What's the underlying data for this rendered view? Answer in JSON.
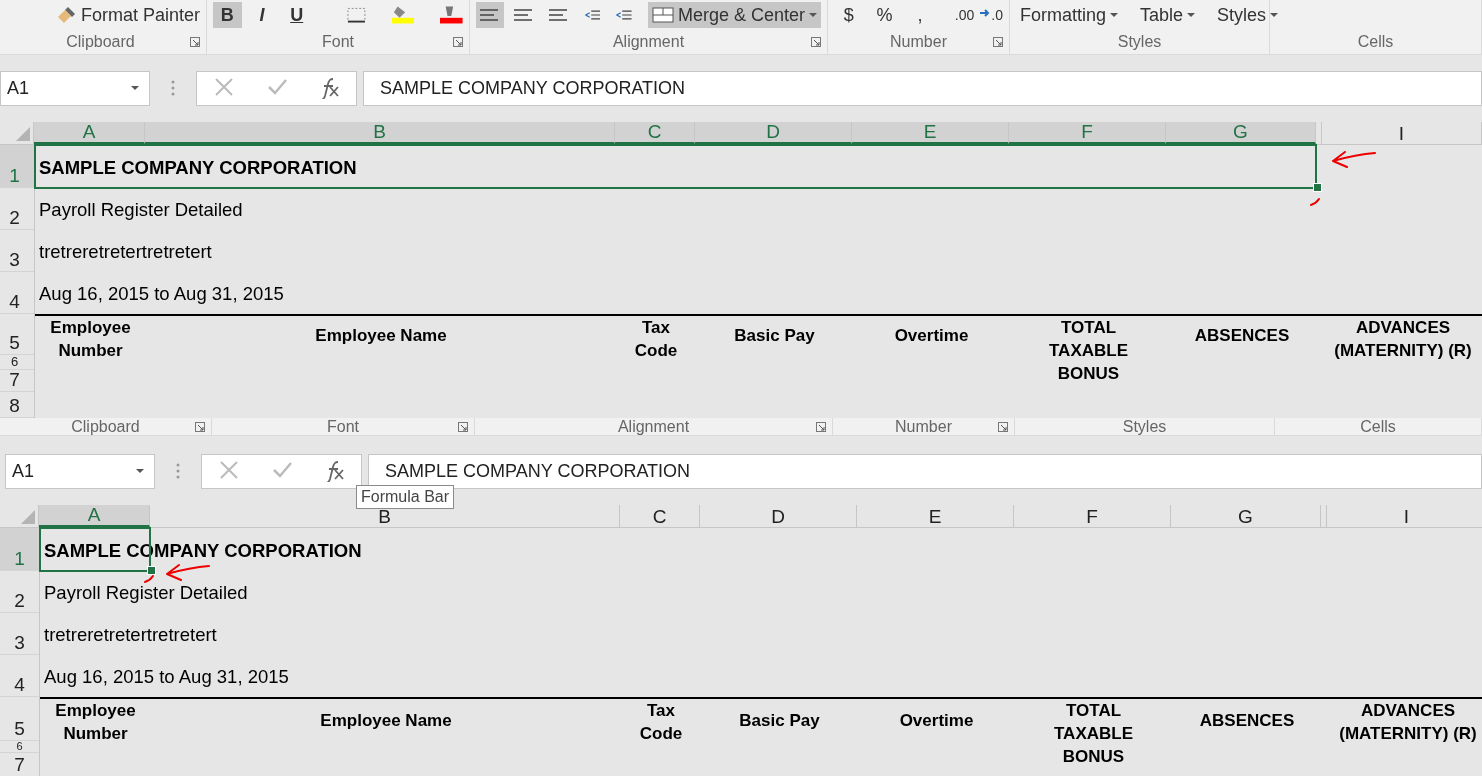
{
  "panels": [
    {
      "ribbon": {
        "groups": [
          {
            "label": "Clipboard",
            "launcher": true,
            "items": [
              {
                "kind": "caret"
              },
              {
                "kind": "brush",
                "text": "Format Painter"
              }
            ]
          },
          {
            "label": "Font",
            "launcher": true,
            "items": [
              {
                "kind": "glyph",
                "text": "B",
                "selected": true
              },
              {
                "kind": "glyph",
                "text": "I",
                "selected": false
              },
              {
                "kind": "glyph",
                "text": "U",
                "selected": false
              },
              {
                "kind": "borders"
              },
              {
                "kind": "fill"
              },
              {
                "kind": "fontcolor"
              }
            ]
          },
          {
            "label": "Alignment",
            "launcher": true,
            "items": [
              {
                "kind": "align",
                "selected": true
              },
              {
                "kind": "align",
                "selected": false
              },
              {
                "kind": "align",
                "selected": false
              },
              {
                "kind": "indent"
              },
              {
                "kind": "indent"
              },
              {
                "kind": "merge",
                "text": "Merge & Center",
                "selected": true
              }
            ]
          },
          {
            "label": "Number",
            "launcher": true,
            "items": [
              {
                "kind": "glyph",
                "text": "$"
              },
              {
                "kind": "glyph",
                "text": "%"
              },
              {
                "kind": "glyph",
                "text": ","
              },
              {
                "kind": "decimal",
                "text": ".00"
              },
              {
                "kind": "decimal-arrow",
                "text": ".0"
              }
            ]
          },
          {
            "label": "Styles",
            "launcher": false,
            "items": [
              {
                "kind": "dropdown",
                "text": "Formatting"
              },
              {
                "kind": "dropdown",
                "text": "Table"
              },
              {
                "kind": "dropdown",
                "text": "Styles"
              }
            ]
          },
          {
            "label": "Cells",
            "launcher": false,
            "items": [
              {
                "kind": "caret"
              },
              {
                "kind": "caret"
              },
              {
                "kind": "caret"
              }
            ]
          }
        ]
      },
      "name_box": "A1",
      "formula": "SAMPLE COMPANY CORPORATION",
      "columns": [
        {
          "label": "A",
          "selected": true
        },
        {
          "label": "B",
          "selected": true
        },
        {
          "label": "C",
          "selected": true
        },
        {
          "label": "D",
          "selected": true
        },
        {
          "label": "E",
          "selected": true
        },
        {
          "label": "F",
          "selected": true
        },
        {
          "label": "G",
          "selected": true
        },
        {
          "label": "I",
          "selected": false
        }
      ],
      "rows": [
        {
          "number": "1",
          "selected": true
        },
        {
          "number": "2",
          "selected": false
        },
        {
          "number": "3",
          "selected": false
        },
        {
          "number": "4",
          "selected": false
        },
        {
          "number": "5",
          "selected": false
        },
        {
          "number": "6",
          "selected": false
        },
        {
          "number": "7",
          "selected": false
        },
        {
          "number": "8",
          "selected": false
        }
      ],
      "lines": [
        {
          "kind": "title",
          "text": "SAMPLE COMPANY CORPORATION"
        },
        {
          "kind": "plain",
          "text": "Payroll Register Detailed"
        },
        {
          "kind": "plain",
          "text": "tretreretretertretretert"
        },
        {
          "kind": "plain",
          "text": "Aug 16, 2015 to Aug 31, 2015"
        }
      ],
      "headers": [
        "Employee Number",
        "Employee Name",
        "Tax Code",
        "Basic Pay",
        "Overtime",
        "TOTAL TAXABLE BONUS",
        "ABSENCES",
        "ADVANCES (MATERNITY) (R)"
      ]
    },
    {
      "ribbon": {
        "groups": [
          {
            "label": "Clipboard",
            "launcher": true
          },
          {
            "label": "Font",
            "launcher": true
          },
          {
            "label": "Alignment",
            "launcher": true
          },
          {
            "label": "Number",
            "launcher": true
          },
          {
            "label": "Styles",
            "launcher": false
          },
          {
            "label": "Cells",
            "launcher": false
          }
        ]
      },
      "name_box": "A1",
      "formula": "SAMPLE COMPANY CORPORATION",
      "tooltip": "Formula Bar",
      "columns": [
        {
          "label": "A",
          "selected": true
        },
        {
          "label": "B",
          "selected": false
        },
        {
          "label": "C",
          "selected": false
        },
        {
          "label": "D",
          "selected": false
        },
        {
          "label": "E",
          "selected": false
        },
        {
          "label": "F",
          "selected": false
        },
        {
          "label": "G",
          "selected": false
        },
        {
          "label": "I",
          "selected": false
        }
      ],
      "rows": [
        {
          "number": "1",
          "selected": true
        },
        {
          "number": "2",
          "selected": false
        },
        {
          "number": "3",
          "selected": false
        },
        {
          "number": "4",
          "selected": false
        },
        {
          "number": "5",
          "selected": false
        },
        {
          "number": "6",
          "selected": false
        },
        {
          "number": "7",
          "selected": false
        }
      ],
      "lines": [
        {
          "kind": "title",
          "text": "SAMPLE COMPANY CORPORATION"
        },
        {
          "kind": "plain",
          "text": "Payroll Register Detailed"
        },
        {
          "kind": "plain",
          "text": "tretreretretertretretert"
        },
        {
          "kind": "plain",
          "text": "Aug 16, 2015 to Aug 31, 2015"
        }
      ],
      "headers": [
        "Employee Number",
        "Employee Name",
        "Tax Code",
        "Basic Pay",
        "Overtime",
        "TOTAL TAXABLE BONUS",
        "ABSENCES",
        "ADVANCES (MATERNITY) (R)"
      ]
    }
  ]
}
